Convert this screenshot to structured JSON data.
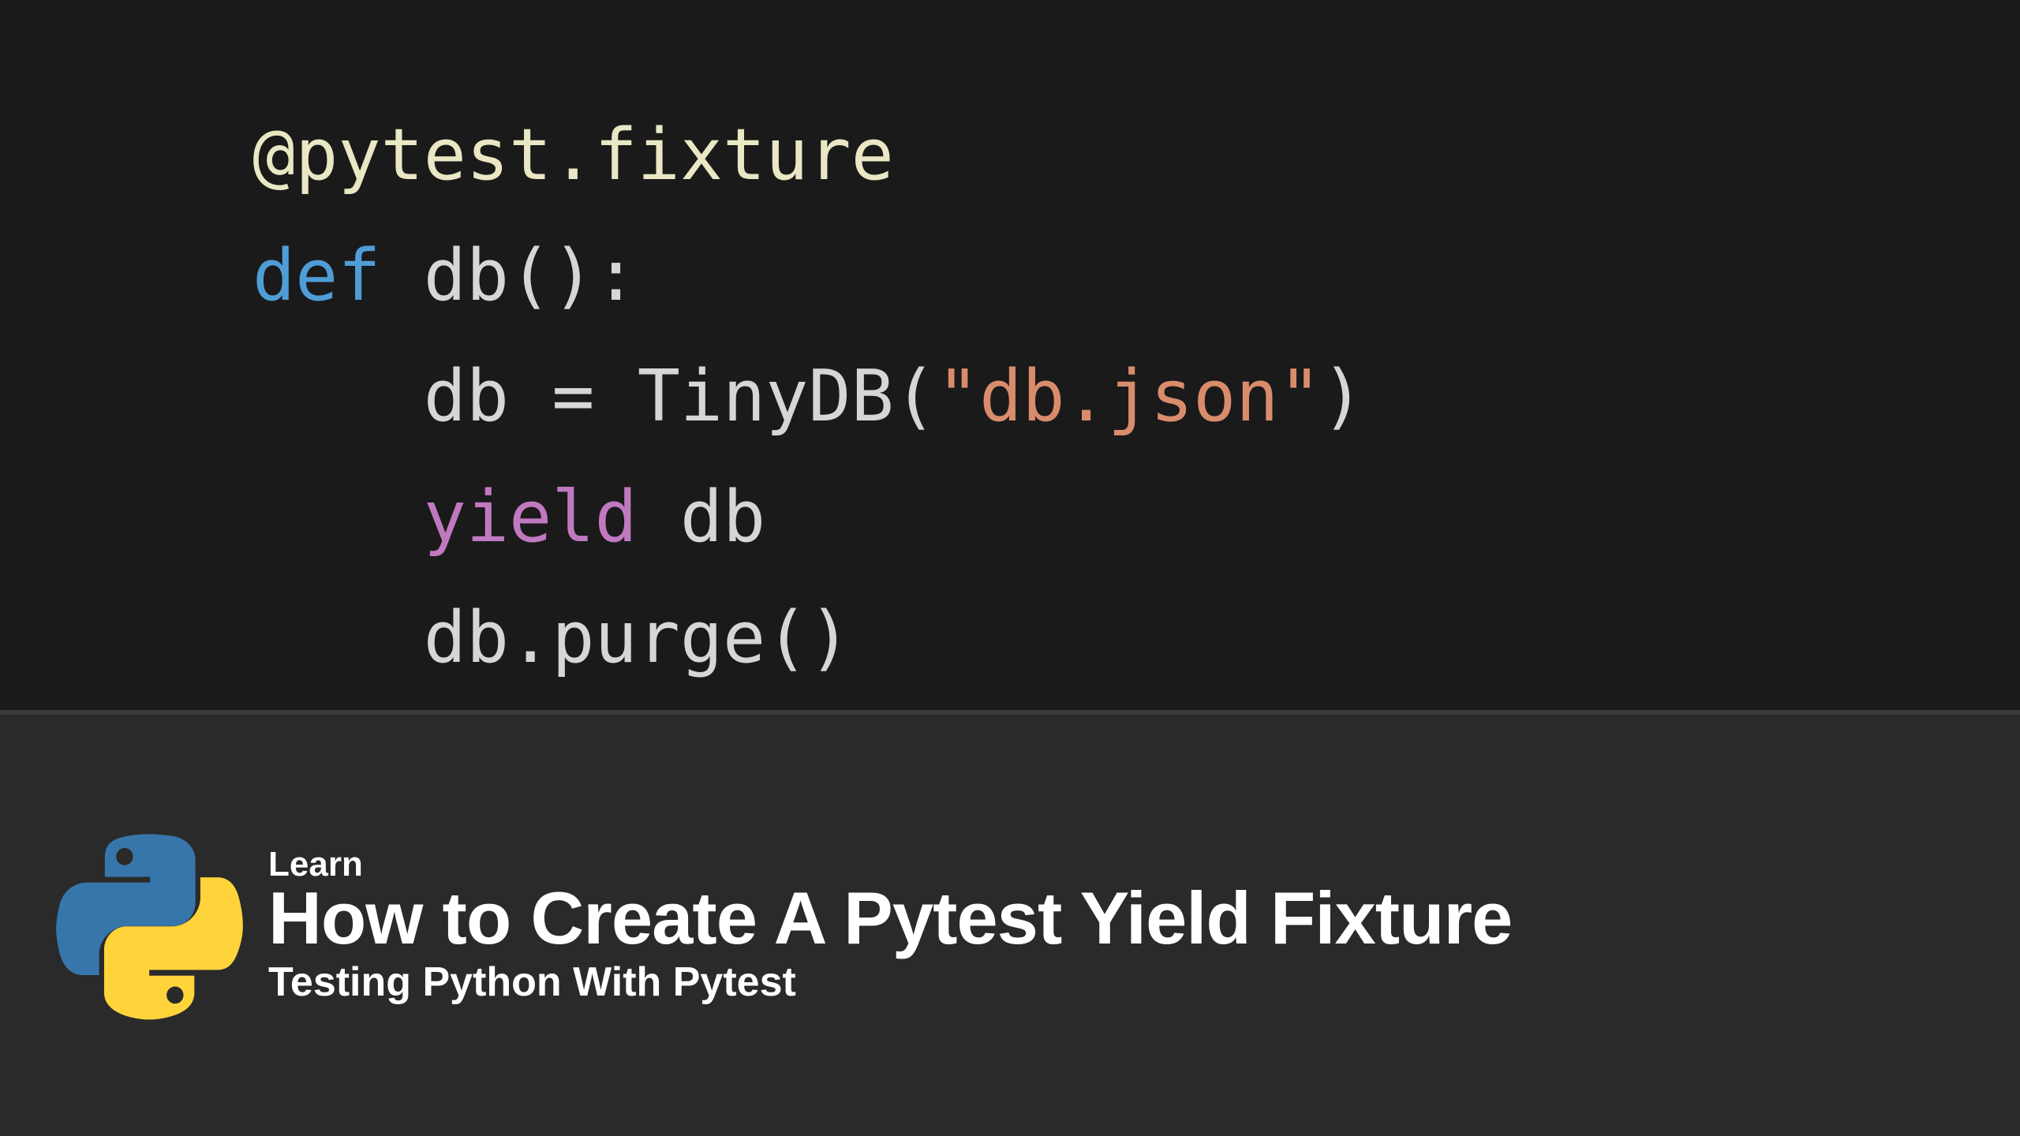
{
  "code": {
    "decorator_at": "@",
    "decorator_name": "pytest.fixture",
    "def_kw": "def",
    "fn_name": "db",
    "paren_open": "(",
    "paren_close": ")",
    "colon": ":",
    "indent": "    ",
    "db_ident": "db",
    "assign": " = ",
    "class_name": "TinyDB",
    "call_open": "(",
    "string_arg": "\"db.json\"",
    "call_close": ")",
    "yield_kw": "yield",
    "space": " ",
    "dot": ".",
    "method_name": "purge",
    "method_open": "(",
    "method_close": ")"
  },
  "banner": {
    "kicker": "Learn",
    "title": "How to Create A Pytest Yield Fixture",
    "subtitle": "Testing Python With Pytest"
  },
  "icons": {
    "python_logo": "python-logo"
  },
  "colors": {
    "code_bg": "#1a1a1a",
    "banner_bg": "#2a2a2a",
    "text": "#ffffff",
    "code_text": "#d6d6d6",
    "decorator": "#e9e7c4",
    "keyword": "#4e9dd6",
    "string": "#d98c6c",
    "yield": "#c079c0",
    "python_blue": "#3776AB",
    "python_yellow": "#FFD43B"
  }
}
